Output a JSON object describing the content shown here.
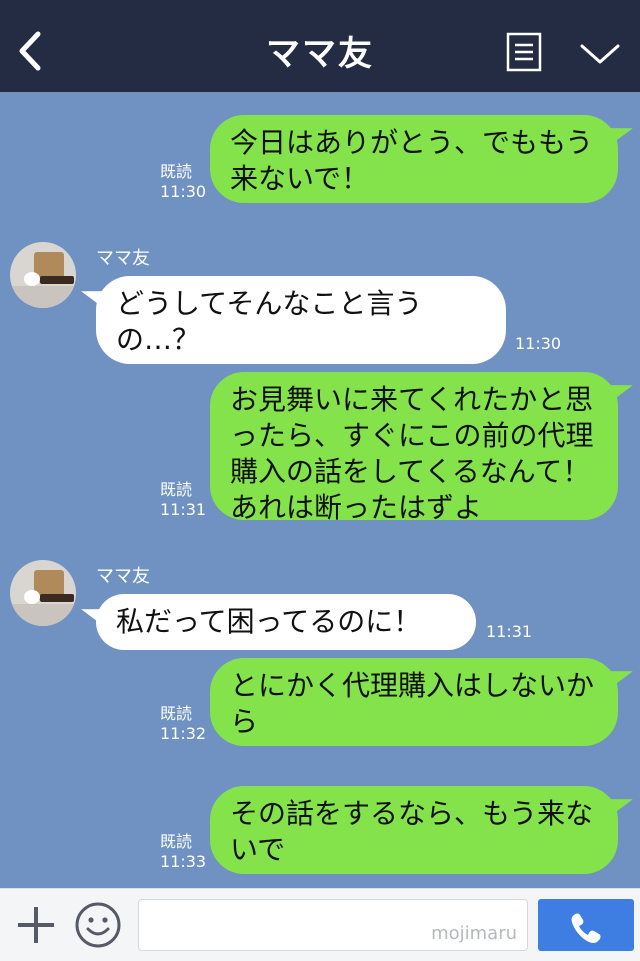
{
  "header": {
    "title": "ママ友",
    "back_icon": "chevron-left-icon",
    "menu_icon": "document-menu-icon",
    "expand_icon": "chevron-down-icon",
    "bg_color": "#232c42"
  },
  "chat": {
    "bg_color": "#7092c2",
    "me_bubble_color": "#84e34a",
    "other_bubble_color": "#ffffff",
    "messages": [
      {
        "from": "me",
        "text": "今日はありがとう、でももう来ないで！",
        "read_label": "既読",
        "time": "11:30"
      },
      {
        "from": "other",
        "sender": "ママ友",
        "text": "どうしてそんなこと言うの…？",
        "time": "11:30"
      },
      {
        "from": "me",
        "text": "お見舞いに来てくれたかと思ったら、すぐにこの前の代理購入の話をしてくるなんて！あれは断ったはずよ",
        "read_label": "既読",
        "time": "11:31"
      },
      {
        "from": "other",
        "sender": "ママ友",
        "text": "私だって困ってるのに！",
        "time": "11:31"
      },
      {
        "from": "me",
        "text": "とにかく代理購入はしないから",
        "read_label": "既読",
        "time": "11:32"
      },
      {
        "from": "me",
        "text": "その話をするなら、もう来ないで",
        "read_label": "既読",
        "time": "11:33"
      }
    ]
  },
  "bottom_bar": {
    "plus_icon": "plus-icon",
    "emoji_icon": "smiley-icon",
    "watermark": "mojimaru",
    "call_icon": "phone-icon",
    "call_color": "#3e7de2"
  }
}
